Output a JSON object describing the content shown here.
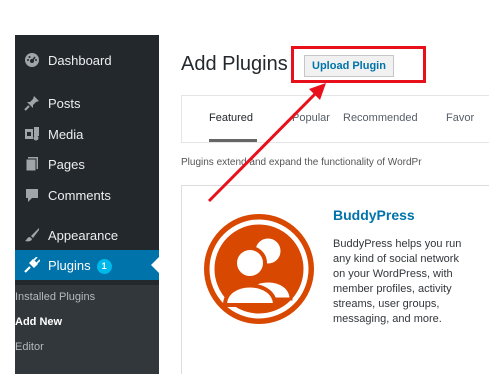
{
  "sidebar": {
    "items": [
      {
        "label": "Dashboard",
        "icon": "dashboard-icon"
      },
      {
        "label": "Posts",
        "icon": "pin-icon"
      },
      {
        "label": "Media",
        "icon": "media-icon"
      },
      {
        "label": "Pages",
        "icon": "pages-icon"
      },
      {
        "label": "Comments",
        "icon": "comment-icon"
      },
      {
        "label": "Appearance",
        "icon": "brush-icon"
      },
      {
        "label": "Plugins",
        "icon": "plug-icon",
        "badge": "1",
        "active": true
      }
    ],
    "submenu": [
      {
        "label": "Installed Plugins"
      },
      {
        "label": "Add New",
        "current": true
      },
      {
        "label": "Editor"
      }
    ]
  },
  "header": {
    "title": "Add Plugins",
    "upload_button": "Upload Plugin"
  },
  "tabs": [
    {
      "label": "Featured",
      "current": true
    },
    {
      "label": "Popular"
    },
    {
      "label": "Recommended"
    },
    {
      "label": "Favor"
    }
  ],
  "description": "Plugins extend and expand the functionality of WordPr",
  "plugin": {
    "name": "BuddyPress",
    "description": "BuddyPress helps you run any kind of social network on your WordPress, with member profiles, activity streams, user groups, messaging, and more.",
    "icon": "buddypress-icon"
  },
  "colors": {
    "sidebar_bg": "#23282d",
    "active_bg": "#0073aa",
    "badge_bg": "#00b9eb",
    "highlight_red": "#e8101b",
    "plugin_orange": "#d84800"
  }
}
